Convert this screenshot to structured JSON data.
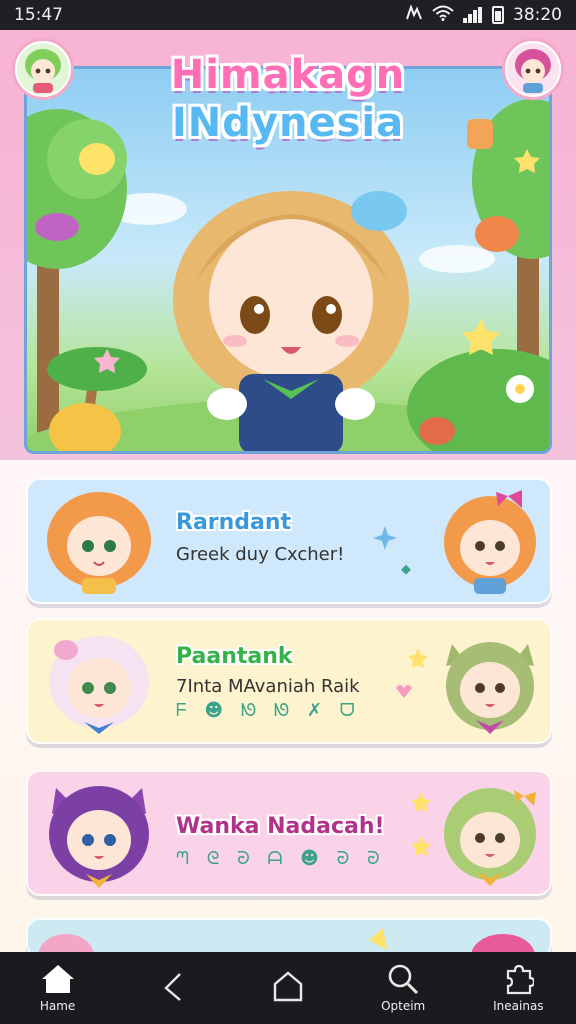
{
  "status_bar": {
    "time_left": "15:47",
    "time_right": "38:20"
  },
  "hero": {
    "title_line1": "Himakagn",
    "title_line2": "INdynesia"
  },
  "cards": [
    {
      "title": "Rarndant",
      "subtitle": "Greek duy Cxcher!",
      "icons": "",
      "color": "#cfe8fb",
      "title_color": "#3a9ad9"
    },
    {
      "title": "Paantank",
      "subtitle": "7Inta MAvaniah Raik",
      "icons": "ᖴ ☻ ᘚ ᘚ ✗ ᗜ",
      "color": "#fdf3cf",
      "title_color": "#35b34a"
    },
    {
      "title": "Wanka Nadacah!",
      "subtitle": "",
      "icons": "ᘉ ᘓ ᘒ ᗩ ☻ ᘒ ᘒ",
      "color": "#fbd3e8",
      "title_color": "#b0338a"
    }
  ],
  "nav": {
    "home_label": "Hame",
    "back_label": "",
    "home2_label": "",
    "search_label": "Opteim",
    "more_label": "Ineainas"
  },
  "colors": {
    "hero_pink": "#f7b3d3",
    "hero_frame": "#6fa4d8",
    "nav_bg": "#1b1b1f"
  }
}
